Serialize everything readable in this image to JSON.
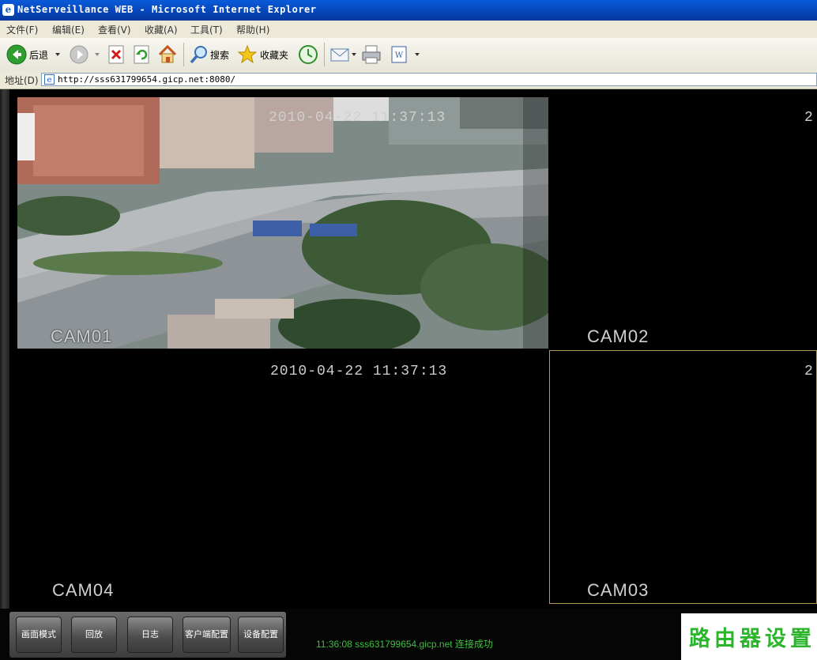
{
  "window": {
    "title": "NetServeillance WEB - Microsoft Internet Explorer"
  },
  "menu": [
    {
      "label": "文件(F)"
    },
    {
      "label": "编辑(E)"
    },
    {
      "label": "查看(V)"
    },
    {
      "label": "收藏(A)"
    },
    {
      "label": "工具(T)"
    },
    {
      "label": "帮助(H)"
    }
  ],
  "toolbar": {
    "back_label": "后退",
    "search_label": "搜索",
    "favorites_label": "收藏夹",
    "icons": [
      "back-icon",
      "forward-icon",
      "stop-icon",
      "refresh-icon",
      "home-icon",
      "search-icon",
      "favorites-icon",
      "history-icon",
      "mail-icon",
      "print-icon",
      "word-icon"
    ]
  },
  "address": {
    "label": "地址(D)",
    "url": "http://sss631799654.gicp.net:8080/"
  },
  "cameras": [
    {
      "label": "CAM01",
      "timestamp": "2010-04-22 11:37:13"
    },
    {
      "label": "CAM02",
      "timestamp": "2"
    },
    {
      "label": "CAM04",
      "timestamp": "2010-04-22 11:37:13"
    },
    {
      "label": "CAM03",
      "timestamp": "2"
    }
  ],
  "controls": {
    "buttons": [
      {
        "label": "画面模式"
      },
      {
        "label": "回放"
      },
      {
        "label": "日志"
      },
      {
        "label": "客户端配置"
      },
      {
        "label": "设备配置"
      }
    ],
    "status": "11:36:08  sss631799654.gicp.net 连接成功"
  },
  "watermark": {
    "text": "路由器设置"
  },
  "colors": {
    "titlebar": "#0a5bd9",
    "status_text": "#3fbf3f",
    "watermark": "#2ab52a",
    "active_cell_border": "#b09a50"
  }
}
